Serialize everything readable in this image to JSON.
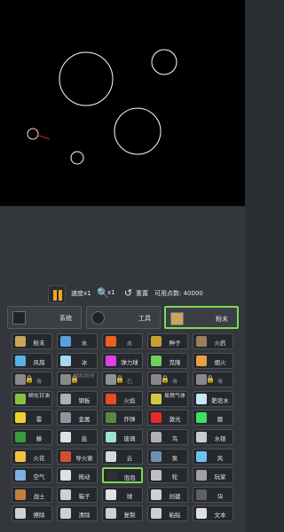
{
  "toolbar": {
    "speed_label": "速度x1",
    "zoom_label": "x1",
    "reset_label": "重置",
    "points_label": "可用点数: 40000"
  },
  "categories": [
    {
      "label": "系统",
      "icon": "system-icon",
      "active": false
    },
    {
      "label": "工具",
      "icon": "gear-icon",
      "active": false
    },
    {
      "label": "粉末",
      "icon": "powder-icon",
      "active": true
    }
  ],
  "elements": [
    [
      {
        "label": "粉末",
        "icon": "powder-icon",
        "color": "#c9a55a"
      },
      {
        "label": "水",
        "icon": "water-icon",
        "color": "#5aa0e0"
      },
      {
        "label": "火",
        "icon": "fire-icon",
        "color": "#e8621e"
      },
      {
        "label": "种子",
        "icon": "seed-icon",
        "color": "#c8a030"
      },
      {
        "label": "火药",
        "icon": "gunpowder-icon",
        "color": "#9a7e58"
      }
    ],
    [
      {
        "label": "风扇",
        "icon": "fan-icon",
        "color": "#5ab0e8"
      },
      {
        "label": "冰",
        "icon": "ice-icon",
        "color": "#a8d8f0"
      },
      {
        "label": "弹力球",
        "icon": "bounce-ball-icon",
        "color": "#e040e8"
      },
      {
        "label": "克隆",
        "icon": "clone-icon",
        "color": "#70d060"
      },
      {
        "label": "烟火",
        "icon": "firework-icon",
        "color": "#e8a040"
      }
    ],
    [
      {
        "label": "毒",
        "icon": "poison-icon",
        "color": "#888888",
        "locked": true
      },
      {
        "label": "物料粉砖",
        "icon": "material-icon",
        "color": "#8a8a8a",
        "locked": true
      },
      {
        "label": "石",
        "icon": "stone-icon",
        "color": "#909090",
        "locked": true
      },
      {
        "label": "毒",
        "icon": "poison-icon",
        "color": "#888888",
        "locked": true
      },
      {
        "label": "毒",
        "icon": "poison-icon",
        "color": "#888888",
        "locked": true
      }
    ],
    [
      {
        "label": "硝化甘油",
        "icon": "nitro-icon",
        "color": "#88c040"
      },
      {
        "label": "钢板",
        "icon": "steel-icon",
        "color": "#aab0b8"
      },
      {
        "label": "火焰",
        "icon": "flame-icon",
        "color": "#e84a2a"
      },
      {
        "label": "易燃气体",
        "icon": "gas-icon",
        "color": "#d8c840"
      },
      {
        "label": "肥皂水",
        "icon": "soap-icon",
        "color": "#c8e8f8"
      }
    ],
    [
      {
        "label": "雷",
        "icon": "thunder-icon",
        "color": "#f0d030"
      },
      {
        "label": "金属",
        "icon": "metal-icon",
        "color": "#8c96a4"
      },
      {
        "label": "炸弹",
        "icon": "bomb-icon",
        "color": "#5a8a40"
      },
      {
        "label": "激光",
        "icon": "laser-icon",
        "color": "#e82a2a"
      },
      {
        "label": "酸",
        "icon": "acid-icon",
        "color": "#40e060"
      }
    ],
    [
      {
        "label": "藤",
        "icon": "vine-icon",
        "color": "#3a9a40"
      },
      {
        "label": "盐",
        "icon": "salt-icon",
        "color": "#e0e0e0"
      },
      {
        "label": "玻璃",
        "icon": "glass-icon",
        "color": "#a0e0d0"
      },
      {
        "label": "鸟",
        "icon": "bird-icon",
        "color": "#b0b0b0"
      },
      {
        "label": "水银",
        "icon": "mercury-icon",
        "color": "#c8ccd0"
      }
    ],
    [
      {
        "label": "火花",
        "icon": "spark-icon",
        "color": "#f0c040"
      },
      {
        "label": "导火索",
        "icon": "fuse-icon",
        "color": "#d05030"
      },
      {
        "label": "云",
        "icon": "cloud-icon",
        "color": "#d0d8e0"
      },
      {
        "label": "泵",
        "icon": "pump-icon",
        "color": "#7090b0"
      },
      {
        "label": "风",
        "icon": "wind-icon",
        "color": "#70c0f0"
      }
    ],
    [
      {
        "label": "空气",
        "icon": "air-icon",
        "color": "#80b0e0"
      },
      {
        "label": "拖动",
        "icon": "drag-icon",
        "color": "#e0e0e0"
      },
      {
        "label": "泡泡",
        "icon": "bubble-icon",
        "color": "#303030",
        "selected": true
      },
      {
        "label": "轮",
        "icon": "wheel-icon",
        "color": "#c0c0c0"
      },
      {
        "label": "玩家",
        "icon": "player-icon",
        "color": "#a0a0a0"
      }
    ],
    [
      {
        "label": "战士",
        "icon": "warrior-icon",
        "color": "#c08040"
      },
      {
        "label": "箱子",
        "icon": "box-icon",
        "color": "#d0d0d0"
      },
      {
        "label": "球",
        "icon": "ball-icon",
        "color": "#e0e0e0"
      },
      {
        "label": "创建",
        "icon": "create-icon",
        "color": "#d0d0d0"
      },
      {
        "label": "块",
        "icon": "block-icon",
        "color": "#606060"
      }
    ],
    [
      {
        "label": "擦除",
        "icon": "erase-icon",
        "color": "#d0d0d0"
      },
      {
        "label": "清除",
        "icon": "clear-icon",
        "color": "#d0d0d0"
      },
      {
        "label": "复制",
        "icon": "copy-icon",
        "color": "#d0d0d0"
      },
      {
        "label": "粘贴",
        "icon": "paste-icon",
        "color": "#d0d0d0"
      },
      {
        "label": "文本",
        "icon": "text-icon",
        "color": "#e0e0e0"
      }
    ]
  ]
}
